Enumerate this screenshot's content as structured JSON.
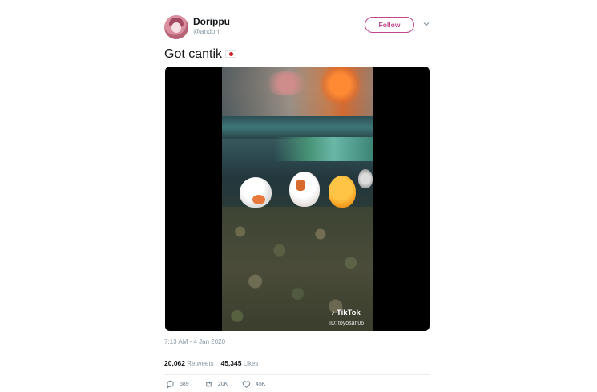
{
  "user": {
    "display_name": "Dorippu",
    "handle": "@andori",
    "follow_label": "Follow"
  },
  "tweet": {
    "text": "Got cantik",
    "emoji": "japan-flag",
    "timestamp": "7:13 AM - 4 Jan 2020"
  },
  "media": {
    "watermark": "TikTok",
    "watermark_id": "ID: toyosan06"
  },
  "stats": {
    "retweets_count": "20,062",
    "retweets_label": "Retweets",
    "likes_count": "45,345",
    "likes_label": "Likes"
  },
  "actions": {
    "reply_count": "589",
    "retweet_count": "20K",
    "like_count": "45K"
  },
  "colors": {
    "accent": "#c0478f",
    "muted": "#8899a6",
    "flag_red": "#d21e2b"
  },
  "icons": [
    "avatar",
    "chevron-down-icon",
    "japan-flag-icon",
    "tiktok-icon",
    "reply-icon",
    "retweet-icon",
    "heart-icon"
  ]
}
